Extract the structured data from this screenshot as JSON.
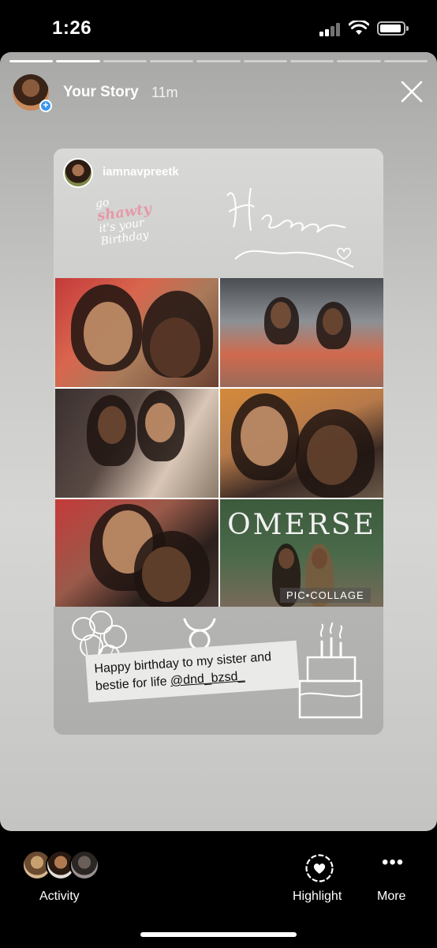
{
  "status_bar": {
    "time": "1:26"
  },
  "story": {
    "title": "Your Story",
    "time_ago": "11m",
    "progress_segments": 9,
    "progress_completed": 2
  },
  "post": {
    "username": "iamnavpreetk",
    "sticker_text": {
      "line1": "go",
      "line2": "shawty",
      "line3": "it's your",
      "line4": "Birthday"
    },
    "script_text": "Happy Birthday",
    "photo_sign": "OMERSE",
    "watermark": "PIC•COLLAGE",
    "caption": "Happy birthday to my sister and bestie for life ",
    "mention": "@dnd_bzsd_"
  },
  "bottom_bar": {
    "activity_label": "Activity",
    "highlight_label": "Highlight",
    "more_label": "More"
  },
  "colors": {
    "background": "#000000",
    "accent_badge": "#3897f0",
    "text": "#ffffff"
  }
}
